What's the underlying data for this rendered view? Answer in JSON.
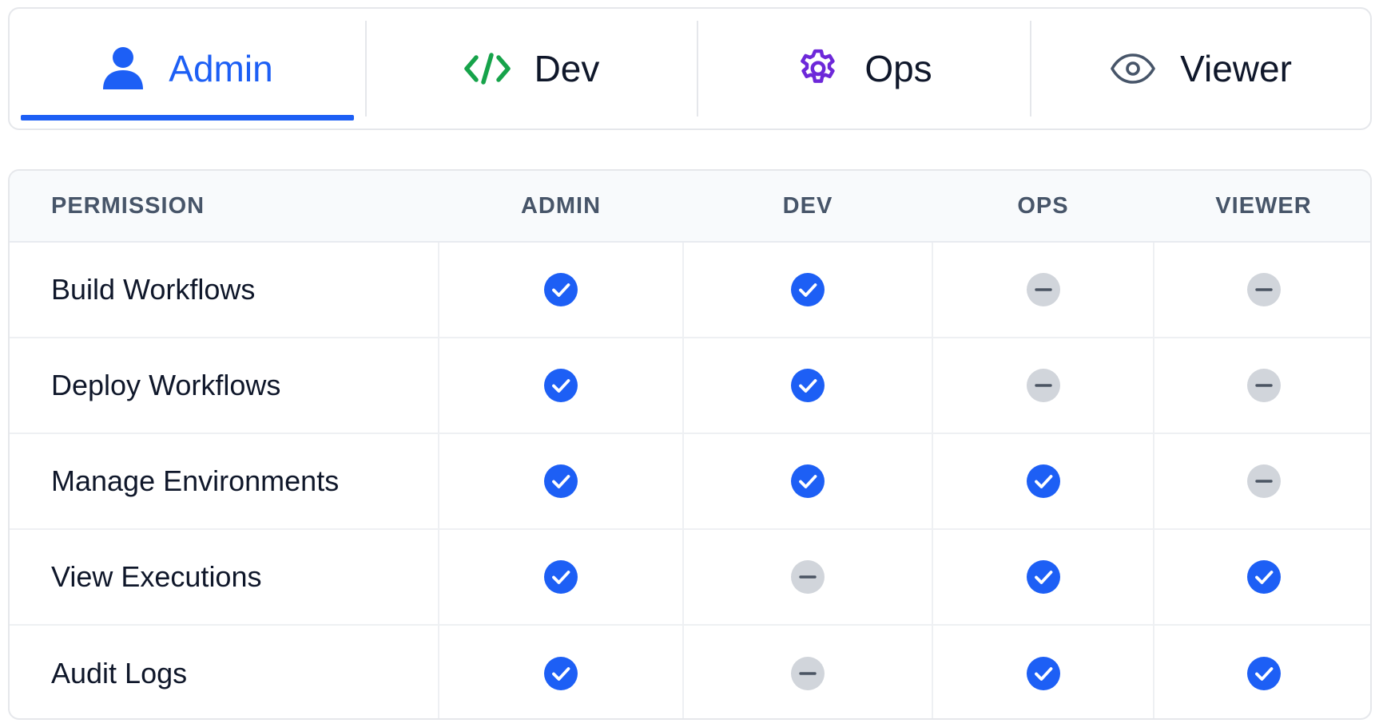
{
  "colors": {
    "accent": "#1d5ff5",
    "dev_icon": "#16a34a",
    "ops_icon": "#6d28d9",
    "viewer_icon": "#475569",
    "granted": "#1d5ff5",
    "denied": "#d1d5db"
  },
  "tabs": [
    {
      "key": "admin",
      "label": "Admin",
      "icon": "user-icon",
      "active": true
    },
    {
      "key": "dev",
      "label": "Dev",
      "icon": "code-icon",
      "active": false
    },
    {
      "key": "ops",
      "label": "Ops",
      "icon": "gear-icon",
      "active": false
    },
    {
      "key": "viewer",
      "label": "Viewer",
      "icon": "eye-icon",
      "active": false
    }
  ],
  "table": {
    "headers": {
      "permission": "PERMISSION",
      "admin": "ADMIN",
      "dev": "DEV",
      "ops": "OPS",
      "viewer": "VIEWER"
    },
    "rows": [
      {
        "name": "Build Workflows",
        "admin": true,
        "dev": true,
        "ops": false,
        "viewer": false
      },
      {
        "name": "Deploy Workflows",
        "admin": true,
        "dev": true,
        "ops": false,
        "viewer": false
      },
      {
        "name": "Manage Environments",
        "admin": true,
        "dev": true,
        "ops": true,
        "viewer": false
      },
      {
        "name": "View Executions",
        "admin": true,
        "dev": false,
        "ops": true,
        "viewer": true
      },
      {
        "name": "Audit Logs",
        "admin": true,
        "dev": false,
        "ops": true,
        "viewer": true
      }
    ]
  }
}
